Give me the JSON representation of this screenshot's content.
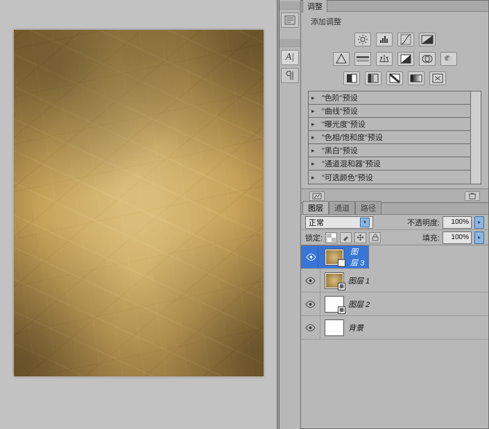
{
  "adjustments": {
    "tab_label": "调整",
    "subhead": "添加调整",
    "presets": [
      "\"色阶\"预设",
      "\"曲线\"预设",
      "\"曝光度\"预设",
      "\"色相/饱和度\"预设",
      "\"黑白\"预设",
      "\"通道混和器\"预设",
      "\"可选颜色\"预设"
    ]
  },
  "layers_panel": {
    "tabs": {
      "layers": "图层",
      "channels": "通道",
      "paths": "路径"
    },
    "blend_mode": "正常",
    "opacity_label": "不透明度:",
    "opacity_value": "100%",
    "lock_label": "锁定:",
    "fill_label": "填充:",
    "fill_value": "100%",
    "layers": [
      {
        "name": "图层 3",
        "selected": true,
        "thumb": "tex",
        "smart": true
      },
      {
        "name": "图层 1",
        "selected": false,
        "thumb": "tex",
        "smart": true
      },
      {
        "name": "图层 2",
        "selected": false,
        "thumb": "checker",
        "smart": true
      },
      {
        "name": "背景",
        "selected": false,
        "thumb": "white",
        "smart": false
      }
    ]
  }
}
